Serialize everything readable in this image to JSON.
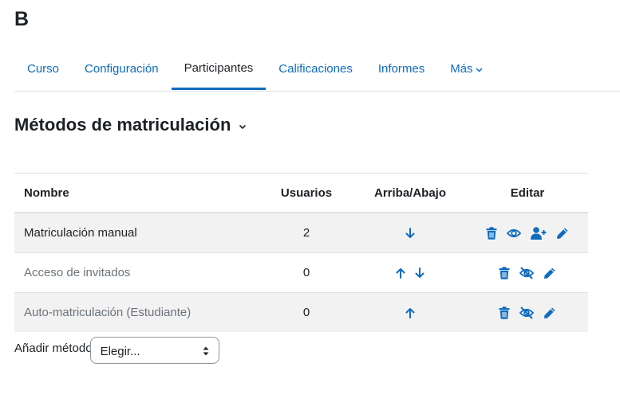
{
  "course": {
    "title": "B"
  },
  "tabs": [
    {
      "label": "Curso"
    },
    {
      "label": "Configuración"
    },
    {
      "label": "Participantes"
    },
    {
      "label": "Calificaciones"
    },
    {
      "label": "Informes"
    },
    {
      "label": "Más"
    }
  ],
  "active_tab": "Participantes",
  "heading": {
    "title": "Métodos de matriculación"
  },
  "table": {
    "headers": {
      "name": "Nombre",
      "users": "Usuarios",
      "updown": "Arriba/Abajo",
      "edit": "Editar"
    },
    "rows": [
      {
        "name": "Matriculación manual",
        "users": "2",
        "enabled": true,
        "actions": [
          "delete-icon",
          "eye-icon",
          "user-plus-icon",
          "pencil-icon"
        ],
        "move": [
          "arrow-down-icon"
        ]
      },
      {
        "name": "Acceso de invitados",
        "users": "0",
        "enabled": false,
        "actions": [
          "delete-icon",
          "eye-slash-icon",
          "pencil-icon"
        ],
        "move": [
          "arrow-up-icon",
          "arrow-down-icon"
        ]
      },
      {
        "name": "Auto-matriculación (Estudiante)",
        "users": "0",
        "enabled": false,
        "actions": [
          "delete-icon",
          "eye-slash-icon",
          "pencil-icon"
        ],
        "move": [
          "arrow-up-icon"
        ]
      }
    ]
  },
  "add_method": {
    "label": "Añadir método",
    "selected": "Elegir..."
  },
  "colors": {
    "accent": "#0f6cbf",
    "text": "#1d2125",
    "muted": "#6a737b",
    "stripe": "#f2f2f2",
    "border": "#dee2e6"
  }
}
